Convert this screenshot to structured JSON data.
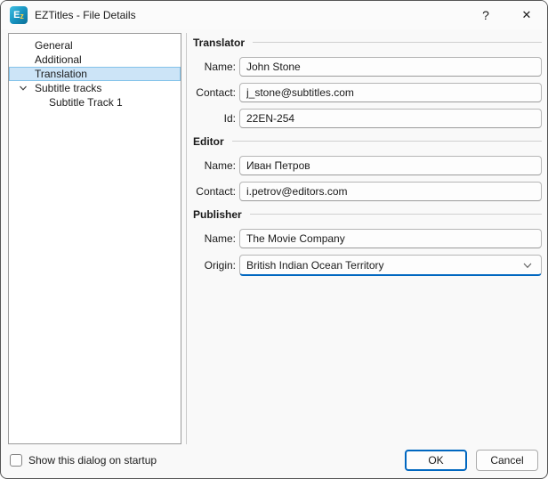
{
  "title_bar": {
    "icon_e": "E",
    "icon_z": "z",
    "title": "EZTitles - File Details",
    "help": "?",
    "close": "✕"
  },
  "tree": {
    "items": [
      {
        "label": "General",
        "level": 1,
        "selected": false
      },
      {
        "label": "Additional",
        "level": 1,
        "selected": false
      },
      {
        "label": "Translation",
        "level": 1,
        "selected": true
      },
      {
        "label": "Subtitle tracks",
        "level": 1,
        "selected": false,
        "expanded": true
      },
      {
        "label": "Subtitle Track 1",
        "level": 2,
        "selected": false
      }
    ]
  },
  "sections": [
    {
      "title": "Translator",
      "fields": [
        {
          "label": "Name:",
          "value": "John Stone",
          "type": "text"
        },
        {
          "label": "Contact:",
          "value": "j_stone@subtitles.com",
          "type": "text"
        },
        {
          "label": "Id:",
          "value": "22EN-254",
          "type": "text"
        }
      ]
    },
    {
      "title": "Editor",
      "fields": [
        {
          "label": "Name:",
          "value": "Иван Петров",
          "type": "text"
        },
        {
          "label": "Contact:",
          "value": "i.petrov@editors.com",
          "type": "text"
        }
      ]
    },
    {
      "title": "Publisher",
      "fields": [
        {
          "label": "Name:",
          "value": "The Movie Company",
          "type": "text"
        },
        {
          "label": "Origin:",
          "value": "British Indian Ocean Territory",
          "type": "select"
        }
      ]
    }
  ],
  "footer": {
    "checkbox_label": "Show this dialog on startup",
    "checkbox_checked": false,
    "ok_label": "OK",
    "cancel_label": "Cancel"
  },
  "colors": {
    "accent": "#0067c0",
    "selection_bg": "#cce4f7",
    "selection_border": "#84c3ea",
    "icon_teal": "#1590bd",
    "icon_letter_yellow": "#ffd23f"
  }
}
